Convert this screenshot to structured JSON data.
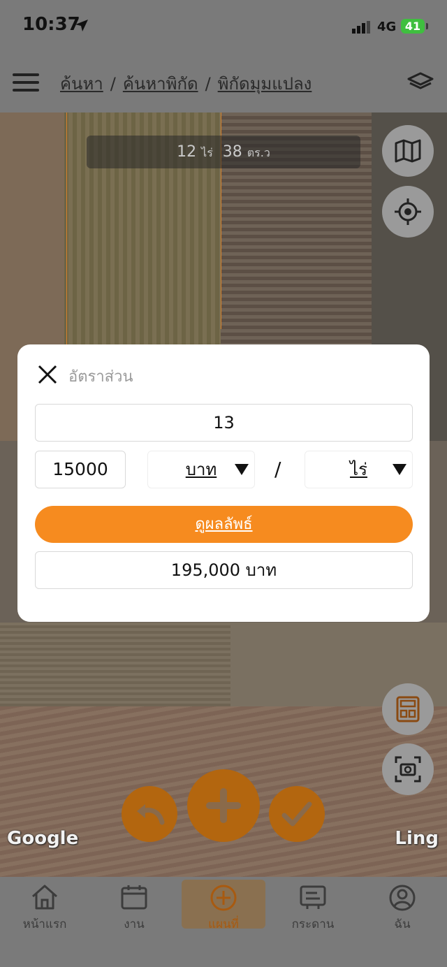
{
  "status_bar": {
    "time": "10:37",
    "network": "4G",
    "battery": "41"
  },
  "header": {
    "breadcrumb": [
      "ค้นหา",
      "ค้นหาพิกัด",
      "พิกัดมุมแปลง"
    ],
    "separator": "/"
  },
  "map": {
    "area_rai": "12",
    "area_rai_unit": "ไร่",
    "area_wa": "38",
    "area_wa_unit": "ตร.ว",
    "attribution_left": "Google",
    "attribution_right": "Ling"
  },
  "modal": {
    "title": "อัตราส่วน",
    "quantity": "13",
    "price": "15000",
    "currency_unit": "บาท",
    "slash": "/",
    "area_unit": "ไร่",
    "result_button": "ดูผลลัพธ์",
    "result": "195,000 บาท"
  },
  "bottom_nav": [
    {
      "label": "หน้าแรก",
      "icon": "home-icon"
    },
    {
      "label": "งาน",
      "icon": "calendar-icon"
    },
    {
      "label": "แผนที่",
      "icon": "plus-circle-icon",
      "active": true
    },
    {
      "label": "กระดาน",
      "icon": "board-icon"
    },
    {
      "label": "ฉัน",
      "icon": "user-icon"
    }
  ],
  "colors": {
    "accent": "#f68b1f",
    "action_dark": "#b3660f"
  }
}
